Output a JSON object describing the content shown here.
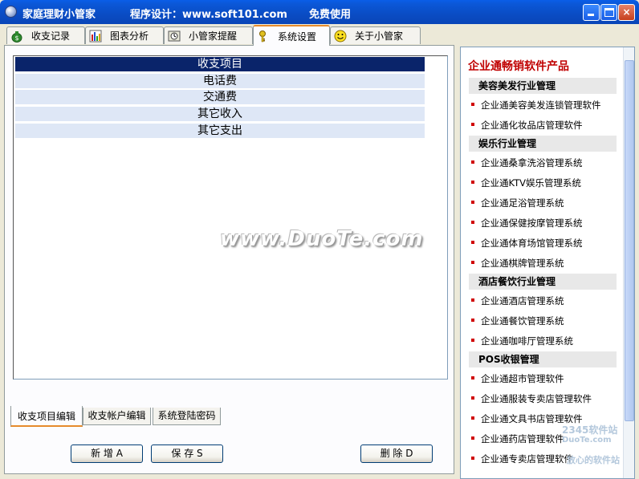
{
  "titlebar": {
    "app_name": "家庭理财小管家",
    "designer": "程序设计：www.soft101.com",
    "free": "免费使用",
    "minimize_icon": "minimize-icon",
    "maximize_icon": "maximize-icon",
    "close_label": "×"
  },
  "tabs": [
    {
      "label": "收支记录",
      "icon": "money-bag-icon"
    },
    {
      "label": "图表分析",
      "icon": "bar-chart-icon"
    },
    {
      "label": "小管家提醒",
      "icon": "clock-icon"
    },
    {
      "label": "系统设置",
      "icon": "key-icon",
      "active": true
    },
    {
      "label": "关于小管家",
      "icon": "smiley-icon"
    }
  ],
  "list": {
    "header": "收支项目",
    "rows": [
      "电话费",
      "交通费",
      "其它收入",
      "其它支出"
    ]
  },
  "bottom_tabs": [
    "收支项目编辑",
    "收支帐户编辑",
    "系统登陆密码"
  ],
  "buttons": {
    "add": "新 增  A",
    "save": "保 存  S",
    "delete": "删 除  D"
  },
  "watermark": "www.DuoTe.com",
  "right_panel": {
    "title": "企业通畅销软件产品",
    "sections": [
      {
        "cat": "美容美发行业管理",
        "items": [
          "企业通美容美发连锁管理软件",
          "企业通化妆品店管理软件"
        ]
      },
      {
        "cat": "娱乐行业管理",
        "items": [
          "企业通桑拿洗浴管理系统",
          "企业通KTV娱乐管理系统",
          "企业通足浴管理系统",
          "企业通保健按摩管理系统",
          "企业通体育场馆管理系统",
          "企业通棋牌管理系统"
        ]
      },
      {
        "cat": "酒店餐饮行业管理",
        "items": [
          "企业通酒店管理系统",
          "企业通餐饮管理系统",
          "企业通咖啡厅管理系统"
        ]
      },
      {
        "cat": "POS收银管理",
        "items": [
          "企业通超市管理软件",
          "企业通服装专卖店管理软件",
          "企业通文具书店管理软件",
          "企业通药店管理软件",
          "企业通专卖店管理软件"
        ]
      }
    ]
  },
  "corner_watermark": {
    "line1": "2345软件站",
    "line2": "DuoTe.com",
    "line3": "放心的软件站"
  },
  "colors": {
    "accent_tab": "#e68b2c",
    "selection": "#0a246a",
    "row_bg": "#dee7f6",
    "promo_red": "#c00000"
  }
}
